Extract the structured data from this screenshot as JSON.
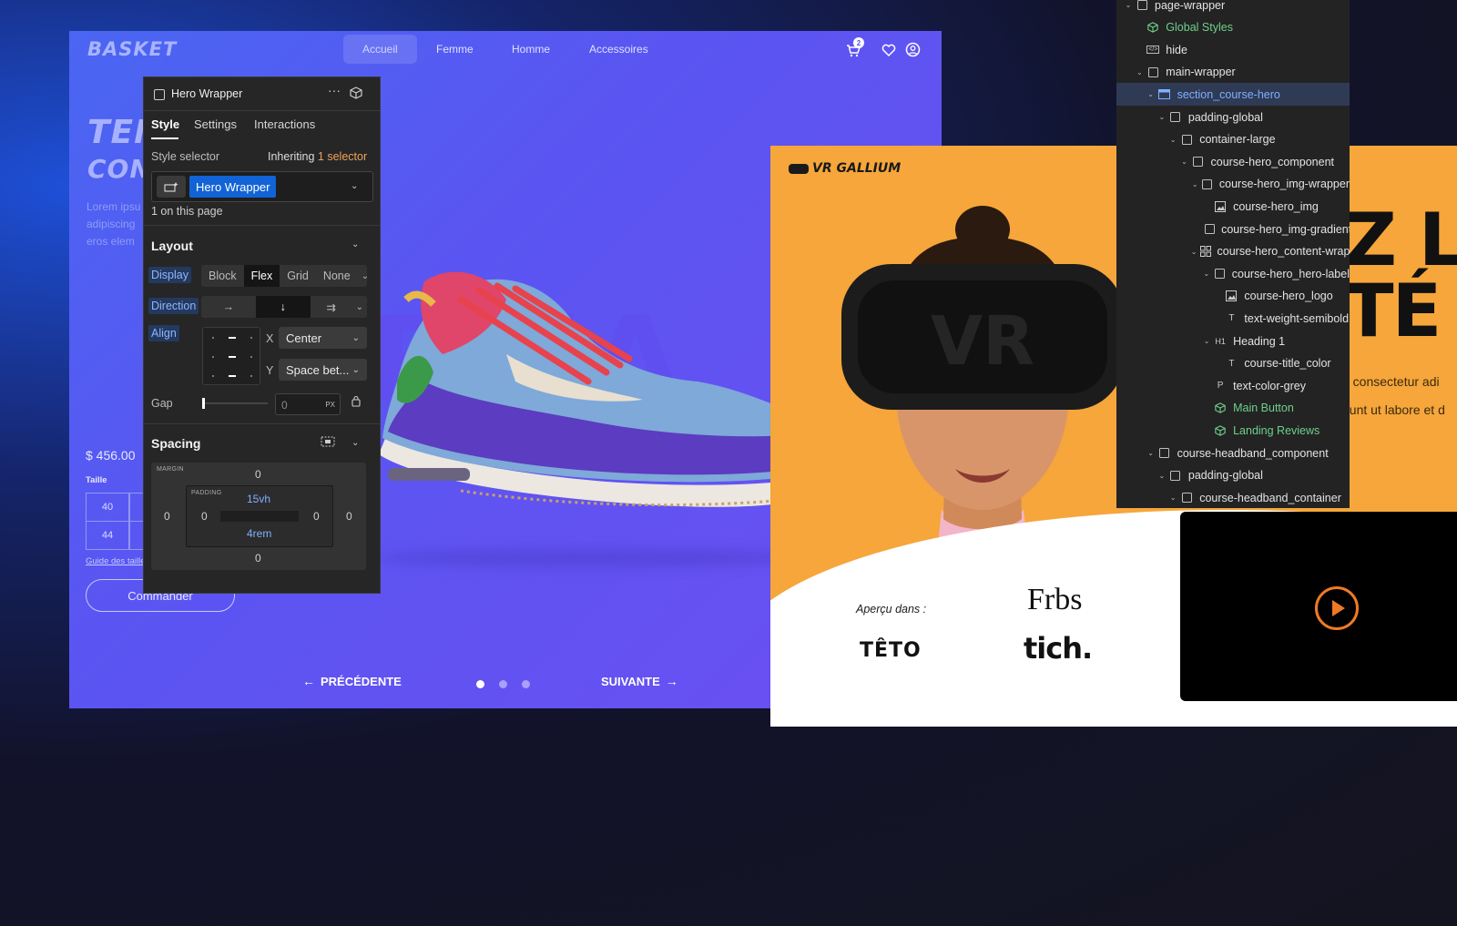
{
  "basket": {
    "logo": "BASKET",
    "nav": [
      "Accueil",
      "Femme",
      "Homme",
      "Accessoires"
    ],
    "cart_count": "2",
    "hero_title": [
      "TEN",
      "CONC"
    ],
    "bg_word": "RMA",
    "desc": [
      "Lorem ipsu",
      "adipiscing",
      "eros elem"
    ],
    "price": "$ 456.00",
    "size_label": "Taille",
    "sizes": [
      "40",
      "44"
    ],
    "size_guide": "Guide des tailles",
    "order_button": "Commander",
    "prev": "PRÉCÉDENTE",
    "next": "SUIVANTE",
    "slide_count": 3,
    "active_slide": 1,
    "shoe_colors": {
      "upper": "#7ba7d8",
      "swoosh": "#e8dfd0",
      "laces": "#e8424d",
      "sole": "#e9e4de",
      "paisley": "#6b3fc0"
    }
  },
  "panel": {
    "title": "Hero Wrapper",
    "tabs": [
      "Style",
      "Settings",
      "Interactions"
    ],
    "style_selector_label": "Style selector",
    "inheriting_text": "Inheriting",
    "inheriting_count": "1 selector",
    "selector_chip": "Hero Wrapper",
    "on_page": "1 on this page",
    "layout_title": "Layout",
    "display_label": "Display",
    "display_options": [
      "Block",
      "Flex",
      "Grid",
      "None"
    ],
    "display_selected": "Flex",
    "direction_label": "Direction",
    "align_label": "Align",
    "align_x_label": "X",
    "align_x": "Center",
    "align_y_label": "Y",
    "align_y": "Space bet...",
    "gap_label": "Gap",
    "gap_value": "0",
    "gap_unit": "PX",
    "spacing_title": "Spacing",
    "margin_label": "MARGIN",
    "padding_label": "PADDING",
    "margin": {
      "top": "0",
      "right": "0",
      "bottom": "0",
      "left": "0"
    },
    "padding": {
      "top": "15vh",
      "right": "0",
      "bottom": "4rem",
      "left": "0"
    }
  },
  "vr": {
    "logo": "VR GALLIUM",
    "headset_text": "VR",
    "big_word": [
      "Z LA",
      "TÉ"
    ],
    "lorem": [
      "t, consectetur adi",
      "dunt ut labore et d"
    ],
    "apercu": "Aperçu dans :",
    "logos": [
      "Frbs",
      "TÊTO",
      "tich."
    ],
    "accent": "#f07a24"
  },
  "navigator": {
    "items": [
      {
        "depth": 0,
        "label": "page-wrapper",
        "icon": "box-icon",
        "caret": true
      },
      {
        "depth": 1,
        "label": "Global Styles",
        "icon": "component-icon",
        "symbol": true
      },
      {
        "depth": 1,
        "label": "hide",
        "icon": "code-embed-icon"
      },
      {
        "depth": 1,
        "label": "main-wrapper",
        "icon": "box-icon",
        "caret": true
      },
      {
        "depth": 2,
        "label": "section_course-hero",
        "icon": "section-icon",
        "caret": true,
        "selected": true
      },
      {
        "depth": 3,
        "label": "padding-global",
        "icon": "box-icon",
        "caret": true
      },
      {
        "depth": 4,
        "label": "container-large",
        "icon": "box-icon",
        "caret": true
      },
      {
        "depth": 5,
        "label": "course-hero_component",
        "icon": "box-icon",
        "caret": true
      },
      {
        "depth": 6,
        "label": "course-hero_img-wrapper",
        "icon": "box-icon",
        "caret": true
      },
      {
        "depth": 7,
        "label": "course-hero_img",
        "icon": "image-icon"
      },
      {
        "depth": 7,
        "label": "course-hero_img-gradient",
        "icon": "box-icon"
      },
      {
        "depth": 6,
        "label": "course-hero_content-wrapper",
        "icon": "grid-icon",
        "caret": true
      },
      {
        "depth": 7,
        "label": "course-hero_hero-label",
        "icon": "box-icon",
        "caret": true
      },
      {
        "depth": 8,
        "label": "course-hero_logo",
        "icon": "image-icon"
      },
      {
        "depth": 8,
        "label": "text-weight-semibold",
        "icon": "text-icon"
      },
      {
        "depth": 7,
        "label": "Heading 1",
        "icon": "heading-icon",
        "caret": true
      },
      {
        "depth": 8,
        "label": "course-title_color",
        "icon": "text-icon"
      },
      {
        "depth": 7,
        "label": "text-color-grey",
        "icon": "paragraph-icon"
      },
      {
        "depth": 7,
        "label": "Main Button",
        "icon": "component-icon",
        "symbol": true
      },
      {
        "depth": 7,
        "label": "Landing Reviews",
        "icon": "component-icon",
        "symbol": true
      },
      {
        "depth": 2,
        "label": "course-headband_component",
        "icon": "box-icon",
        "caret": true
      },
      {
        "depth": 3,
        "label": "padding-global",
        "icon": "box-icon",
        "caret": true
      },
      {
        "depth": 4,
        "label": "course-headband_container",
        "icon": "box-icon",
        "caret": true
      }
    ]
  }
}
